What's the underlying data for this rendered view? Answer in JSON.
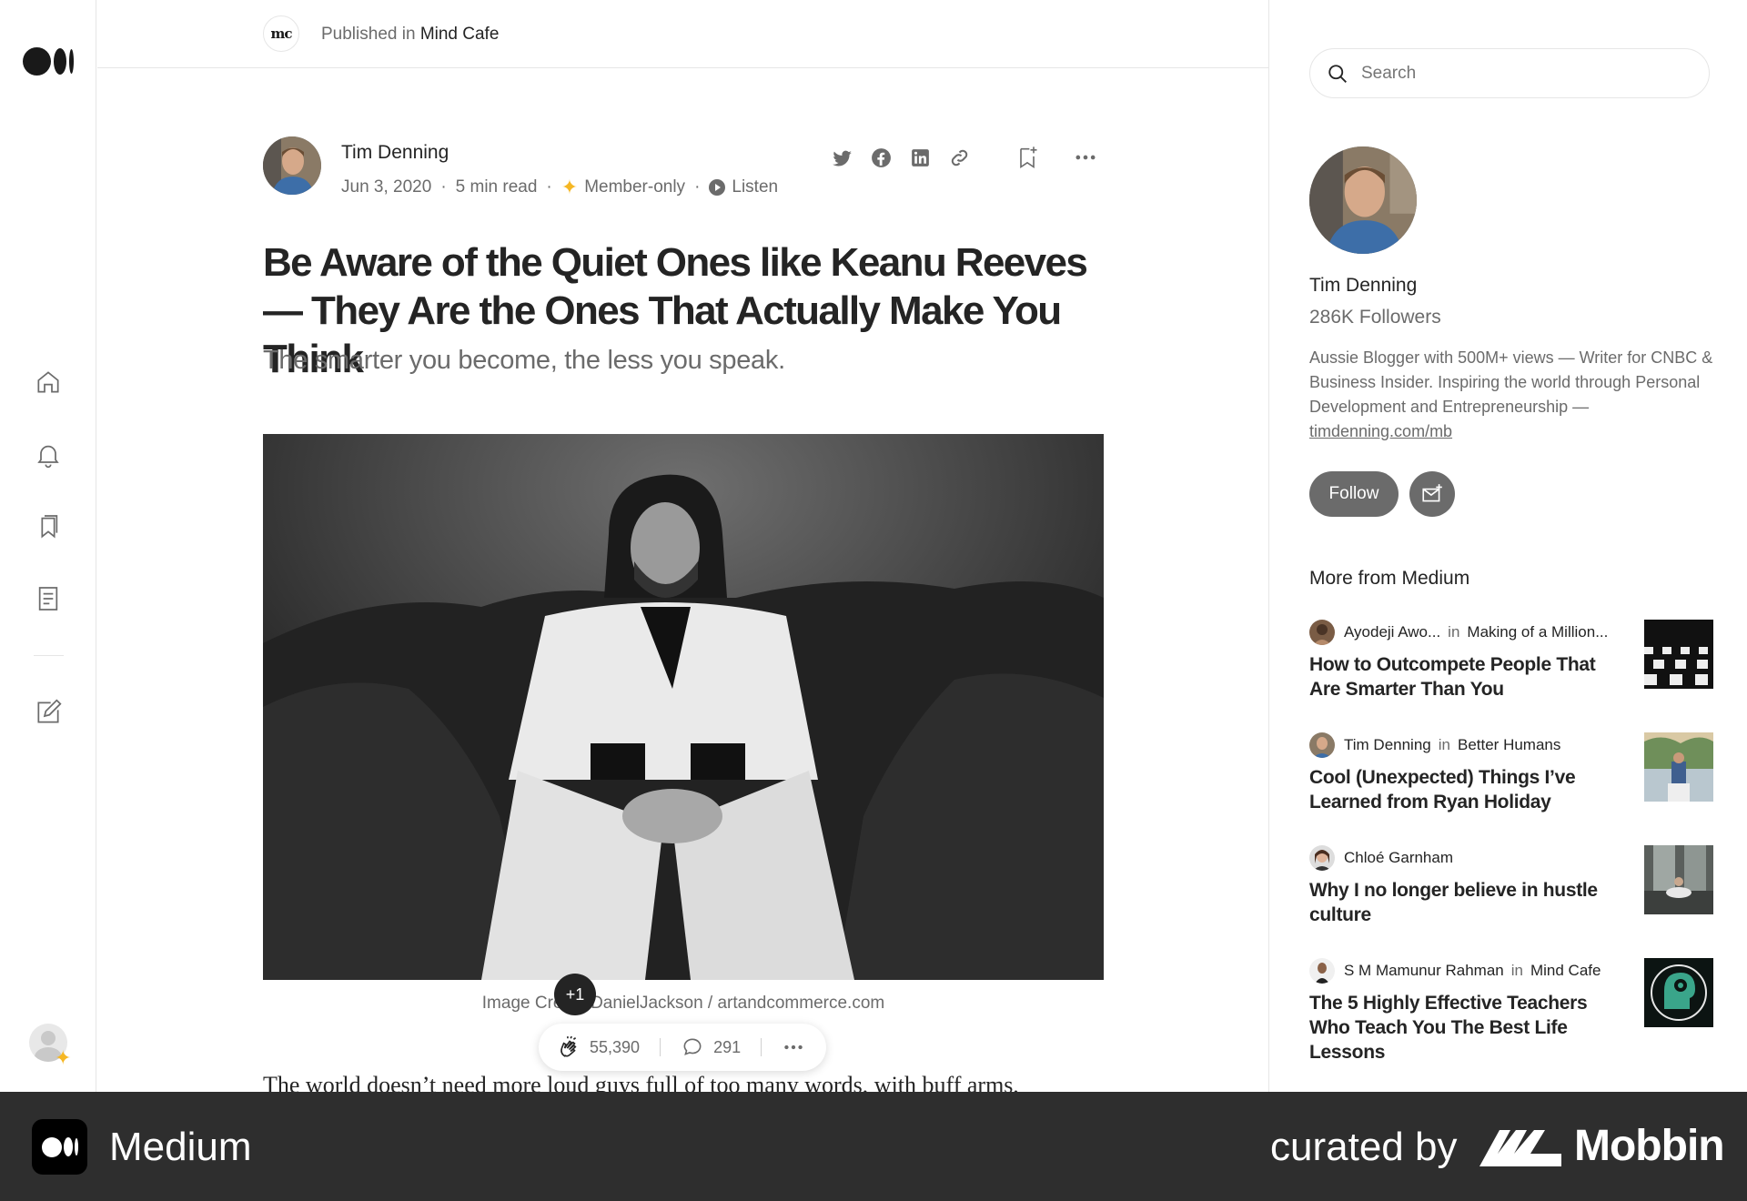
{
  "app": {
    "name": "Medium"
  },
  "publication": {
    "logo_text": "mc",
    "published_in_label": "Published in",
    "name": "Mind Cafe"
  },
  "rail": {
    "icons": [
      "medium-logo-icon",
      "home-icon",
      "bell-icon",
      "bookmarks-icon",
      "stories-icon",
      "write-icon"
    ]
  },
  "article": {
    "author": "Tim Denning",
    "date": "Jun 3, 2020",
    "read_time": "5 min read",
    "member_only": "Member-only",
    "listen": "Listen",
    "title": "Be Aware of the Quiet Ones like Keanu Reeves — They Are the Ones That Actually Make You Think",
    "subtitle": "The smarter you become, the less you speak.",
    "caption": "Image Credit: DanielJackson / artandcommerce.com",
    "body_first_line": "The world doesn’t need more loud guys full of too many words, with buff arms,",
    "share_icons": [
      "twitter-icon",
      "facebook-icon",
      "linkedin-icon",
      "link-icon"
    ]
  },
  "engagement": {
    "clap_badge": "+1",
    "claps": "55,390",
    "responses": "291"
  },
  "sidebar": {
    "search_placeholder": "Search",
    "profile": {
      "name": "Tim Denning",
      "followers": "286K Followers",
      "bio": "Aussie Blogger with 500M+ views — Writer for CNBC & Business Insider. Inspiring the world through Personal Development and Entrepreneurship —",
      "bio_link": "timdenning.com/mb",
      "follow_label": "Follow"
    },
    "more_heading": "More from Medium",
    "recommendations": [
      {
        "author": "Ayodeji Awo...",
        "in": "in",
        "publication": "Making of a Million...",
        "title": "How to Outcompete People That Are Smarter Than You"
      },
      {
        "author": "Tim Denning",
        "in": "in",
        "publication": "Better Humans",
        "title": "Cool (Unexpected) Things I’ve Learned from Ryan Holiday"
      },
      {
        "author": "Chloé Garnham",
        "in": "",
        "publication": "",
        "title": "Why I no longer believe in hustle culture"
      },
      {
        "author": "S M Mamunur Rahman",
        "in": "in",
        "publication": "Mind Cafe",
        "title": "The 5 Highly Effective Teachers Who Teach You The Best Life Lessons"
      }
    ]
  },
  "banner": {
    "app_name": "Medium",
    "curated_by": "curated by",
    "brand": "Mobbin"
  }
}
